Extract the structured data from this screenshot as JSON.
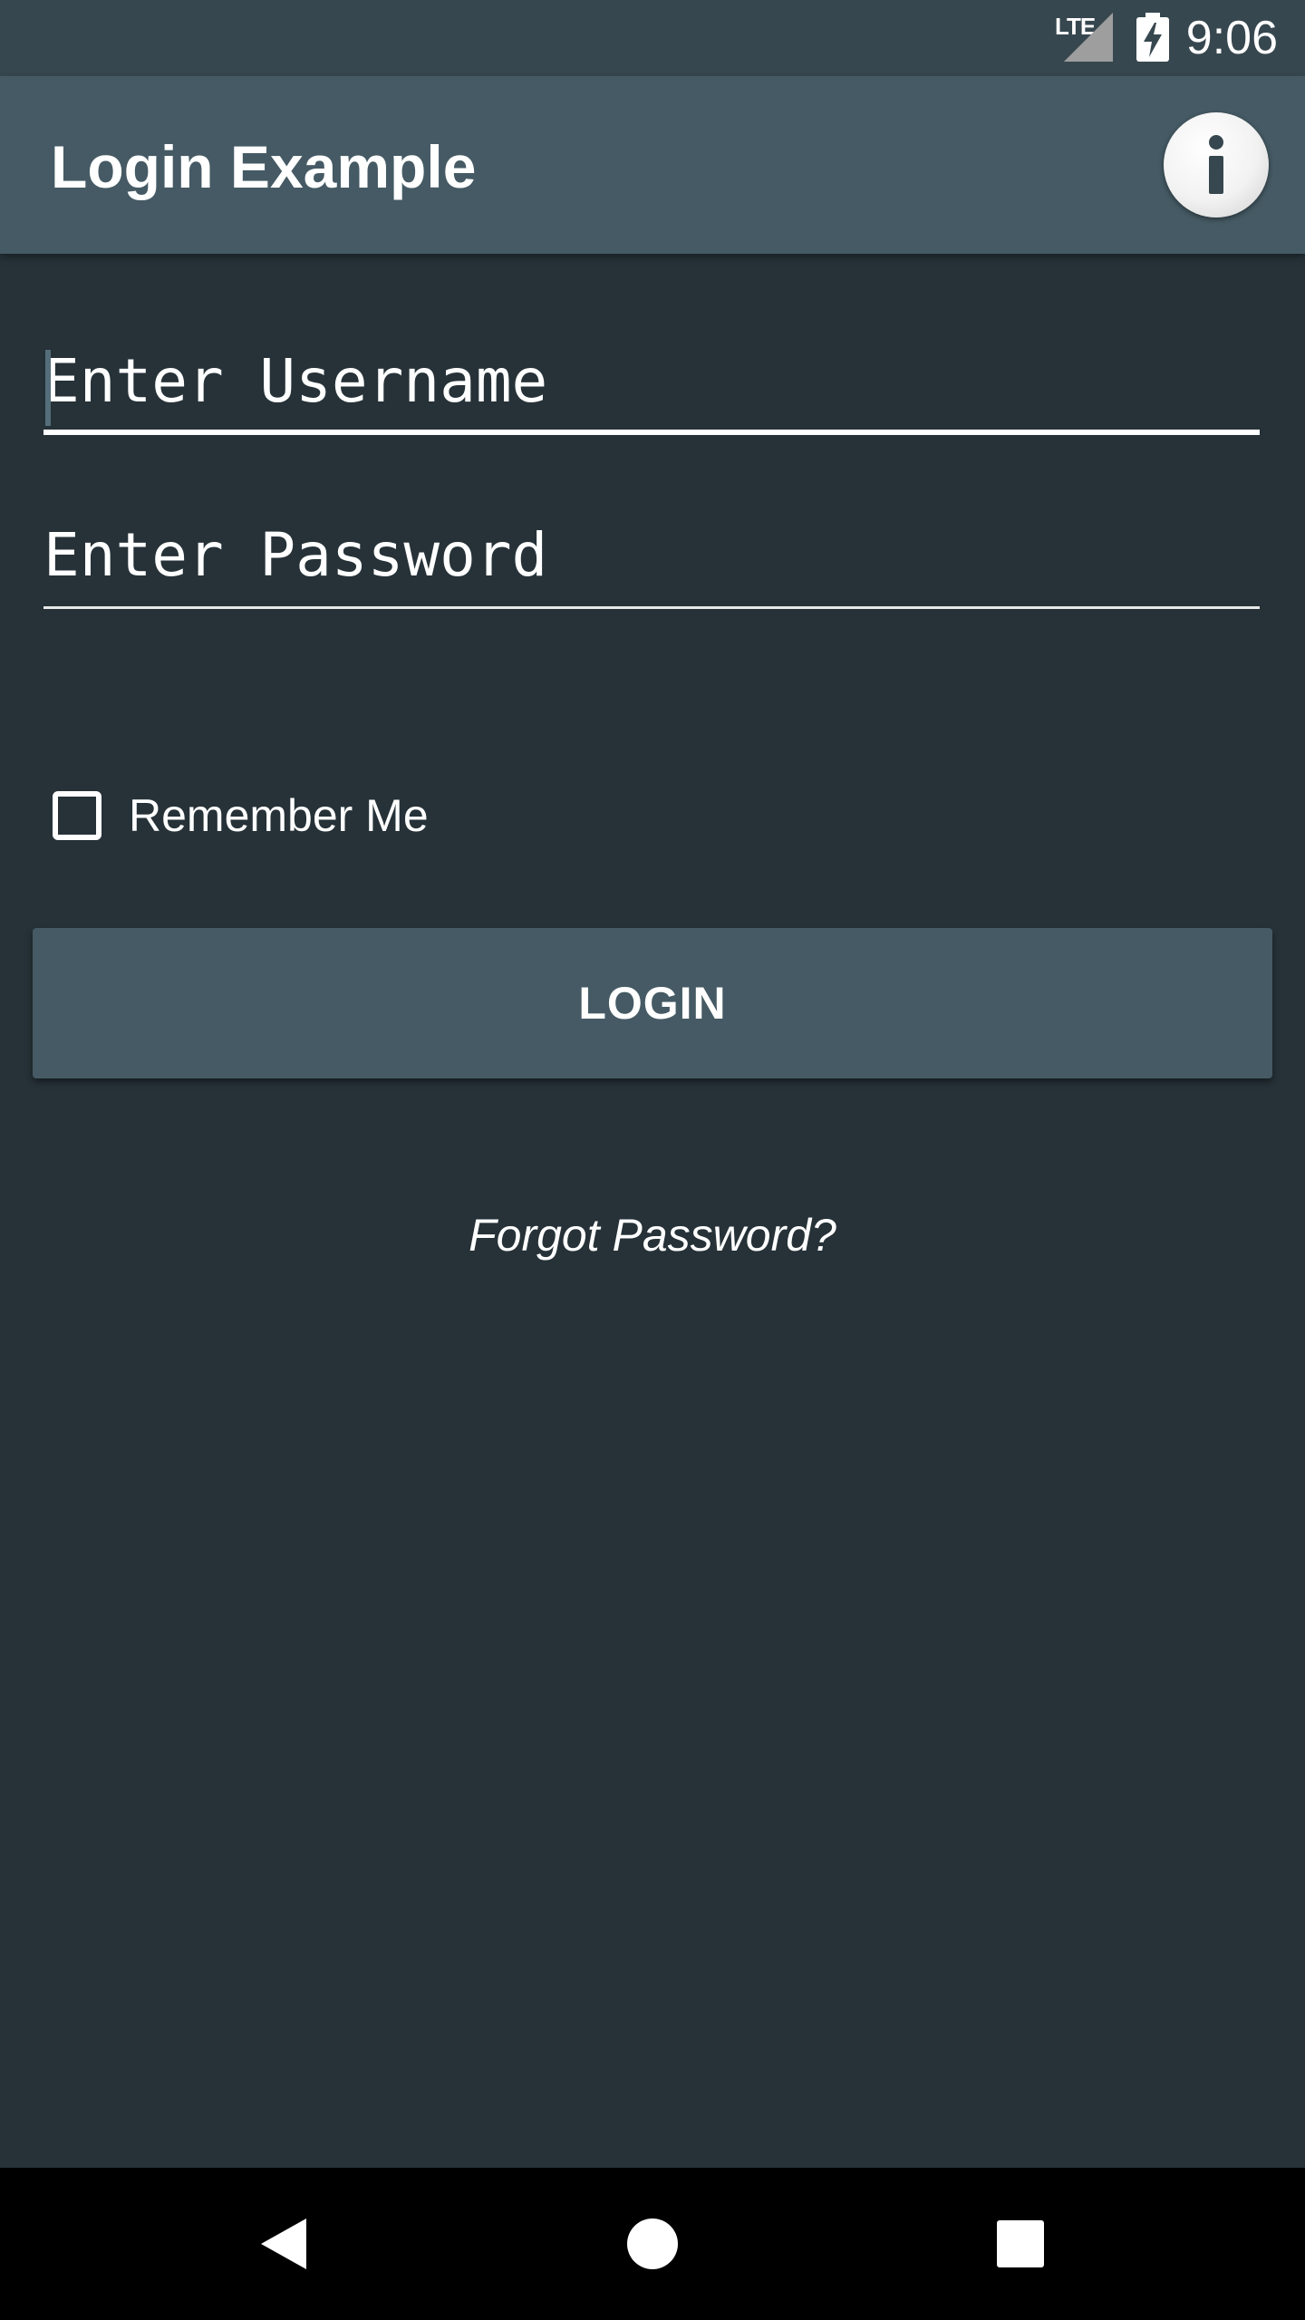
{
  "status_bar": {
    "network": "LTE",
    "time": "9:06",
    "icons": [
      "signal-icon",
      "battery-charging-icon"
    ]
  },
  "app_bar": {
    "title": "Login Example",
    "info_icon": "info-icon"
  },
  "form": {
    "username": {
      "value": "",
      "placeholder": "Enter Username"
    },
    "password": {
      "value": "",
      "placeholder": "Enter Password"
    },
    "remember_me": {
      "label": "Remember Me",
      "checked": false
    },
    "login_button": {
      "label": "LOGIN"
    },
    "forgot_password": {
      "label": "Forgot Password?"
    }
  },
  "nav_bar": {
    "buttons": [
      "back-icon",
      "home-icon",
      "recents-icon"
    ]
  },
  "colors": {
    "background": "#263238",
    "status_bar": "#37474f",
    "app_bar": "#455a64",
    "button": "#455a64",
    "text": "#ffffff",
    "nav_bar": "#000000"
  }
}
